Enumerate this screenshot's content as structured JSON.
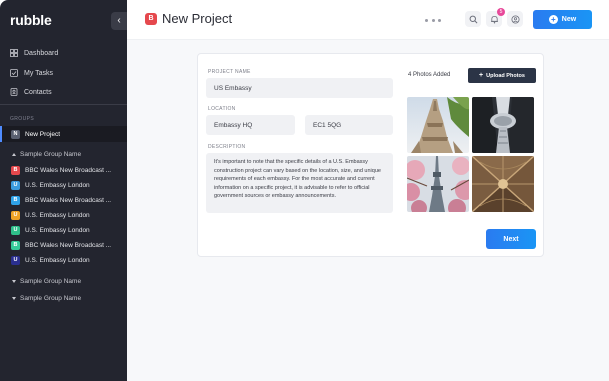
{
  "app": {
    "logo": "rubble",
    "collapse_icon": "chevron-left-icon"
  },
  "sidebar": {
    "nav": [
      {
        "label": "Dashboard",
        "icon": "grid-icon"
      },
      {
        "label": "My Tasks",
        "icon": "checkbox-icon"
      },
      {
        "label": "Contacts",
        "icon": "contact-book-icon"
      }
    ],
    "groups_label": "GROUPS",
    "active_item": {
      "badge": "N",
      "label": "New Project",
      "color": "#5a6070"
    },
    "group_1": {
      "name": "Sample Group Name",
      "items": [
        {
          "badge": "B",
          "label": "BBC Wales New Broadcast ...",
          "color": "#e5484d"
        },
        {
          "badge": "U",
          "label": "U.S. Embassy London",
          "color": "#3b9be0"
        },
        {
          "badge": "B",
          "label": "BBC Wales New Broadcast ...",
          "color": "#2fa3e8"
        },
        {
          "badge": "U",
          "label": "U.S. Embassy London",
          "color": "#f0a325"
        },
        {
          "badge": "U",
          "label": "U.S. Embassy London",
          "color": "#2fc08a"
        },
        {
          "badge": "B",
          "label": "BBC Wales New Broadcast ...",
          "color": "#35c99a"
        },
        {
          "badge": "U",
          "label": "U.S. Embassy London",
          "color": "#2a2f8f"
        }
      ]
    },
    "group_2": {
      "name": "Sample Group Name"
    },
    "group_3": {
      "name": "Sample Group Name"
    }
  },
  "header": {
    "project_badge": "B",
    "title": "New Project",
    "notification_count": "5",
    "new_button": "New"
  },
  "form": {
    "project_name_label": "PROJECT NAME",
    "project_name_value": "US Embassy",
    "location_label": "LOCATION",
    "location_value": "Embassy HQ",
    "postcode_value": "EC1 5QG",
    "description_label": "DESCRIPTION",
    "description_value": "It's important to note that the specific details of a U.S. Embassy construction project can vary based on the location, size, and unique requirements of each embassy. For the most accurate and current information on a specific project, it is advisable to refer to official government sources or embassy announcements.",
    "photos_added": "4 Photos Added",
    "upload_button": "Upload Photos",
    "next_button": "Next"
  },
  "colors": {
    "accent": "#2a7bf0",
    "sidebar_bg": "#23252f",
    "brand_red": "#e5484d"
  }
}
